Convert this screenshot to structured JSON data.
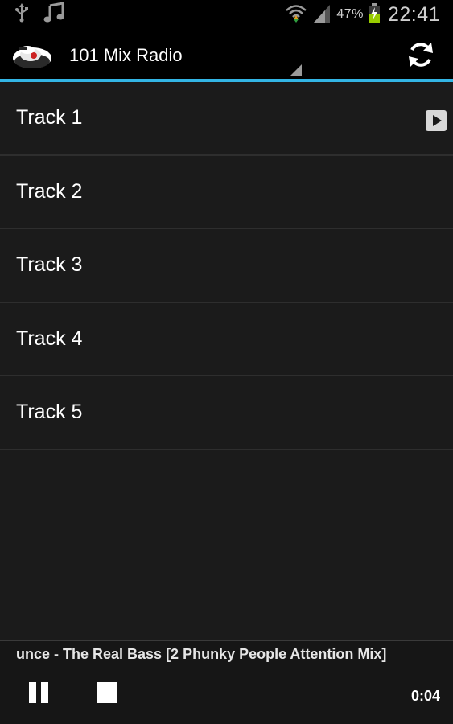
{
  "status_bar": {
    "icons_left": [
      "usb-icon",
      "music-note-icon"
    ],
    "icons_right": [
      "wifi-icon",
      "signal-icon",
      "battery-charging-icon"
    ],
    "battery_percent": "47%",
    "clock": "22:41"
  },
  "action_bar": {
    "logo_icon": "radio-logo-icon",
    "title": "101 Mix Radio",
    "refresh_icon": "refresh-icon",
    "accent_color": "#33b5e5"
  },
  "tracks": [
    {
      "label": "Track 1",
      "playing": true
    },
    {
      "label": "Track 2",
      "playing": false
    },
    {
      "label": "Track 3",
      "playing": false
    },
    {
      "label": "Track 4",
      "playing": false
    },
    {
      "label": "Track 5",
      "playing": false
    }
  ],
  "player": {
    "now_playing": "unce - The Real Bass [2 Phunky People Attention Mix]",
    "elapsed": "0:04",
    "pause_icon": "pause-icon",
    "stop_icon": "stop-icon"
  }
}
